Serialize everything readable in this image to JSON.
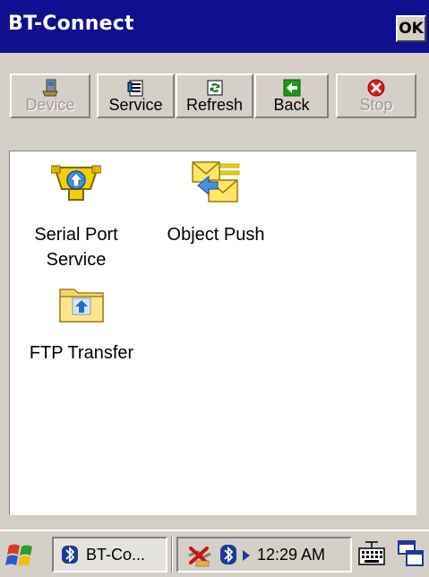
{
  "window": {
    "title": "BT-Connect",
    "ok_label": "OK"
  },
  "toolbar": {
    "buttons": [
      {
        "label": "Device",
        "icon": "device-icon",
        "enabled": false
      },
      {
        "label": "Service",
        "icon": "service-icon",
        "enabled": true
      },
      {
        "label": "Refresh",
        "icon": "refresh-icon",
        "enabled": true
      },
      {
        "label": "Back",
        "icon": "back-arrow-icon",
        "enabled": true
      },
      {
        "label": "Stop",
        "icon": "stop-icon",
        "enabled": false
      }
    ]
  },
  "services": [
    {
      "label_line1": "Serial Port",
      "label_line2": "Service",
      "icon": "serial-port-icon"
    },
    {
      "label_line1": "Object Push",
      "label_line2": "",
      "icon": "object-push-icon"
    },
    {
      "label_line1": "FTP Transfer",
      "label_line2": "",
      "icon": "ftp-folder-icon"
    }
  ],
  "taskbar": {
    "app_label": "BT-Co...",
    "clock": "12:29 AM"
  },
  "colors": {
    "titlebar": "#0f0f8f",
    "face": "#d4d0c8",
    "content_bg": "#ffffff",
    "bluetooth": "#1b3a9a"
  }
}
